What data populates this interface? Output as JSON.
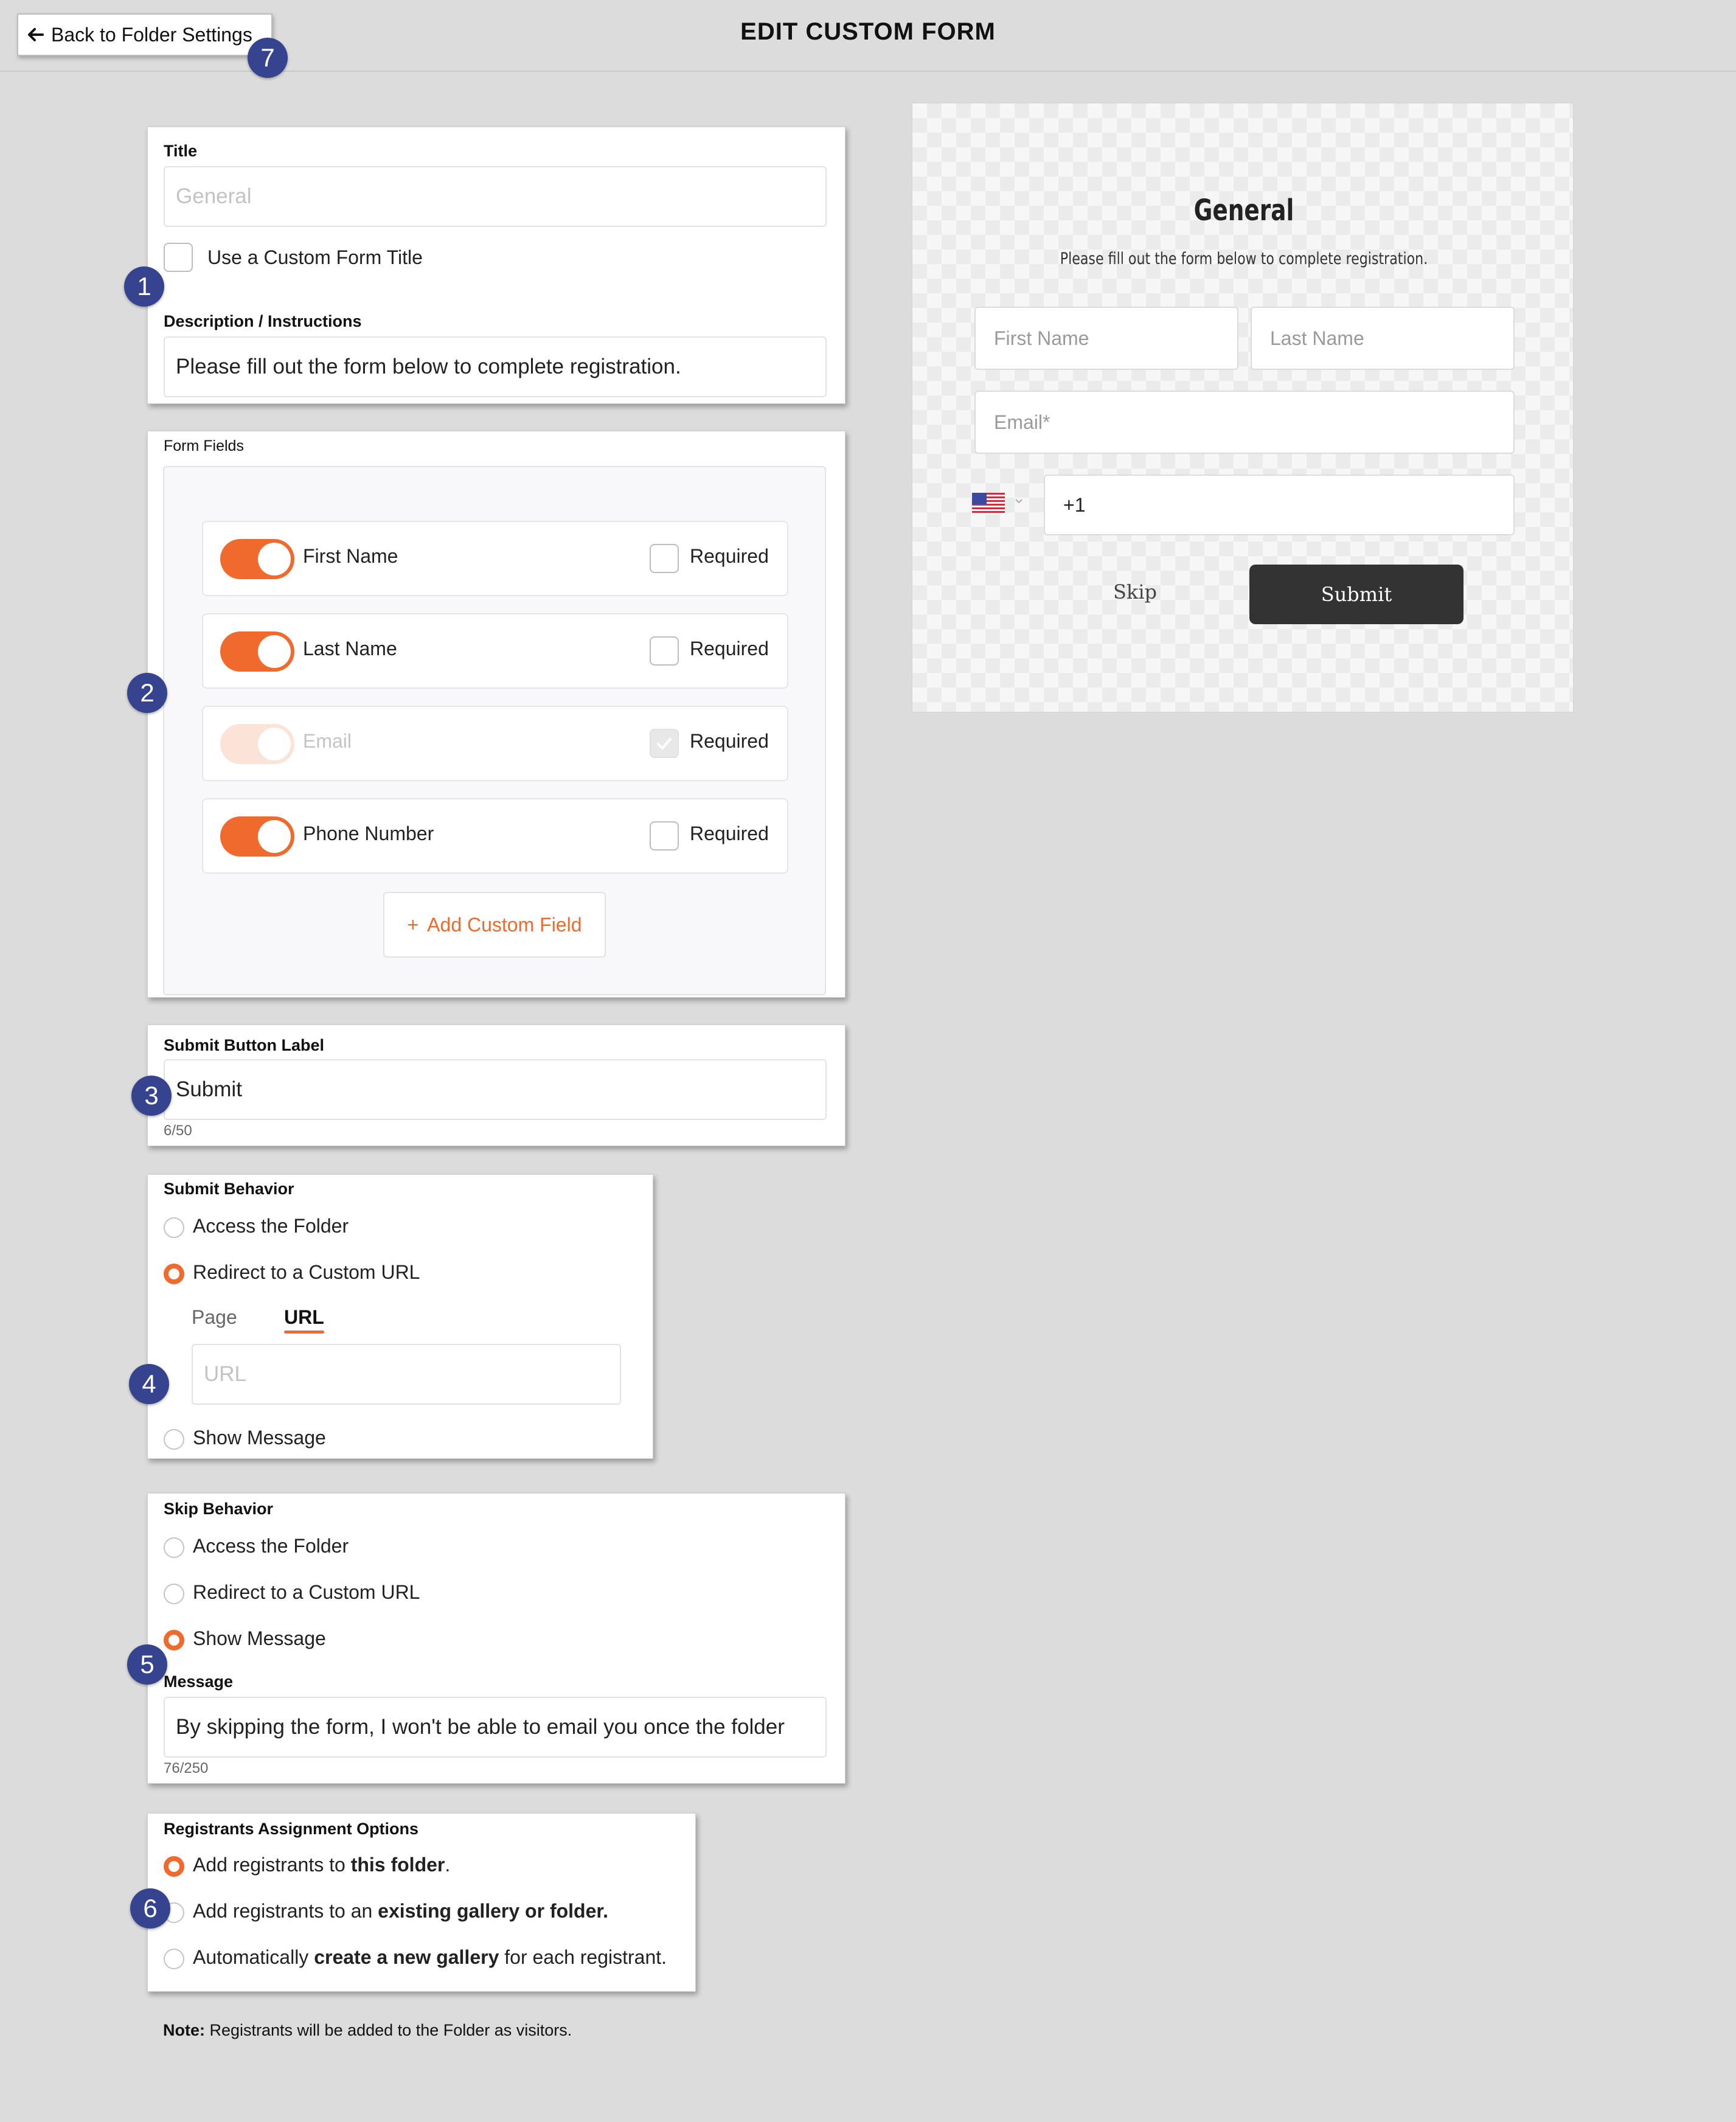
{
  "header": {
    "back_label": "Back to Folder Settings",
    "title": "EDIT CUSTOM FORM"
  },
  "badges": [
    "1",
    "2",
    "3",
    "4",
    "5",
    "6",
    "7"
  ],
  "title_section": {
    "title_label": "Title",
    "title_placeholder": "General",
    "custom_title_label": "Use a Custom Form Title",
    "description_label": "Description / Instructions",
    "description_value": "Please fill out the form below to complete registration."
  },
  "form_fields": {
    "label": "Form Fields",
    "required_label": "Required",
    "fields": [
      {
        "name": "First Name",
        "enabled": true,
        "required": false
      },
      {
        "name": "Last Name",
        "enabled": true,
        "required": false
      },
      {
        "name": "Email",
        "enabled": true,
        "required": true,
        "disabled": true
      },
      {
        "name": "Phone Number",
        "enabled": true,
        "required": false
      }
    ],
    "add_button": "Add Custom Field",
    "add_icon": "+"
  },
  "submit_label_section": {
    "label": "Submit Button Label",
    "value": "Submit",
    "counter": "6/50"
  },
  "submit_behavior": {
    "label": "Submit Behavior",
    "options": [
      "Access the Folder",
      "Redirect to a Custom URL",
      "Show Message"
    ],
    "selected_index": 1,
    "tabs": [
      "Page",
      "URL"
    ],
    "active_tab": "URL",
    "url_placeholder": "URL"
  },
  "skip_behavior": {
    "label": "Skip Behavior",
    "options": [
      "Access the Folder",
      "Redirect to a Custom URL",
      "Show Message"
    ],
    "selected_index": 2,
    "message_label": "Message",
    "message_value": "By skipping the form, I won't be able to email you once the folder",
    "counter": "76/250"
  },
  "registrants": {
    "label": "Registrants Assignment Options",
    "option1_prefix": "Add registrants to ",
    "option1_bold": "this folder",
    "option1_suffix": ".",
    "option2_prefix": "Add registrants to an ",
    "option2_bold": "existing gallery or folder.",
    "option3_prefix": "Automatically ",
    "option3_bold": "create a new gallery",
    "option3_suffix": " for each registrant.",
    "selected_index": 0,
    "note_bold": "Note:",
    "note_text": " Registrants will be added to the Folder as visitors."
  },
  "preview": {
    "title": "General",
    "description": "Please fill out the form below to complete registration.",
    "first_name_placeholder": "First Name",
    "last_name_placeholder": "Last Name",
    "email_placeholder": "Email*",
    "phone_value": "+1",
    "flag_icon": "us-flag-icon",
    "skip_label": "Skip",
    "submit_label": "Submit"
  },
  "colors": {
    "accent": "#ef6a2c",
    "badge": "#36438e",
    "submit_bg": "#333333"
  }
}
